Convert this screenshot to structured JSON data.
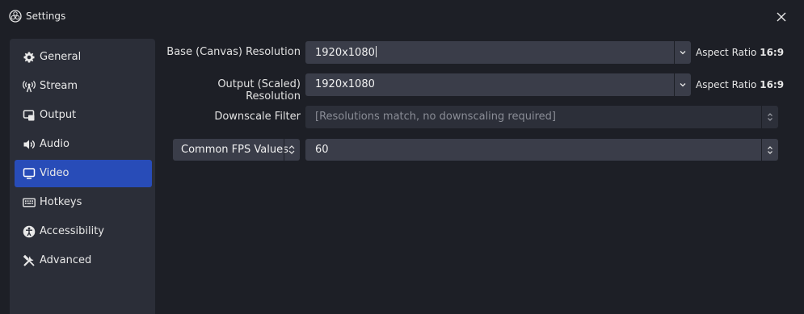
{
  "window": {
    "title": "Settings",
    "logo_icon": "obs-logo-icon",
    "close_icon": "close-icon"
  },
  "sidebar": {
    "items": [
      {
        "label": "General",
        "icon": "gear-icon",
        "active": false
      },
      {
        "label": "Stream",
        "icon": "broadcast-icon",
        "active": false
      },
      {
        "label": "Output",
        "icon": "output-icon",
        "active": false
      },
      {
        "label": "Audio",
        "icon": "speaker-icon",
        "active": false
      },
      {
        "label": "Video",
        "icon": "monitor-icon",
        "active": true
      },
      {
        "label": "Hotkeys",
        "icon": "keyboard-icon",
        "active": false
      },
      {
        "label": "Accessibility",
        "icon": "accessibility-icon",
        "active": false
      },
      {
        "label": "Advanced",
        "icon": "tools-icon",
        "active": false
      }
    ]
  },
  "video": {
    "base_resolution": {
      "label": "Base (Canvas) Resolution",
      "value": "1920x1080",
      "aspect_label": "Aspect Ratio",
      "aspect_value": "16:9"
    },
    "output_resolution": {
      "label": "Output (Scaled) Resolution",
      "value": "1920x1080",
      "aspect_label": "Aspect Ratio",
      "aspect_value": "16:9"
    },
    "downscale_filter": {
      "label": "Downscale Filter",
      "value": "[Resolutions match, no downscaling required]"
    },
    "fps": {
      "type_label": "Common FPS Values",
      "value": "60"
    }
  },
  "colors": {
    "background": "#1d1f26",
    "sidebar": "#2b2e38",
    "active": "#284cb8",
    "field": "#3a3d49"
  }
}
